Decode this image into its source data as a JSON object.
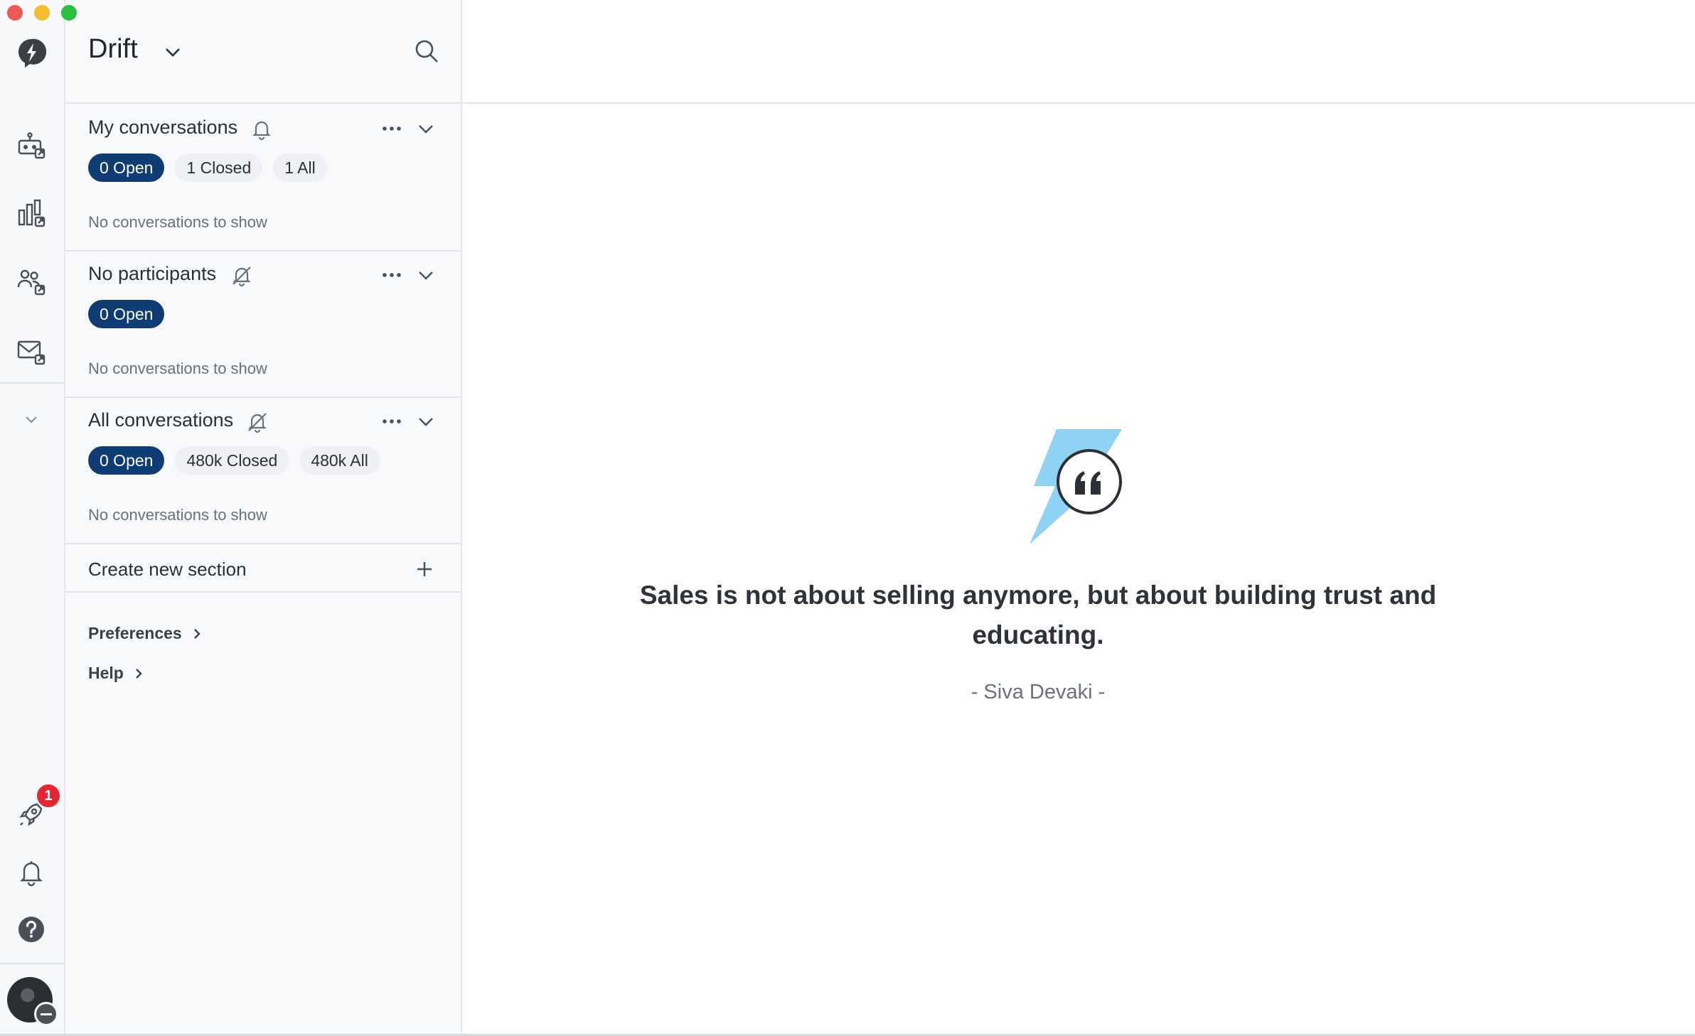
{
  "workspace": {
    "name": "Drift"
  },
  "sections": [
    {
      "title": "My conversations",
      "notifications": "on",
      "pills": [
        {
          "label": "0 Open",
          "active": true
        },
        {
          "label": "1 Closed",
          "active": false
        },
        {
          "label": "1 All",
          "active": false
        }
      ],
      "empty_text": "No conversations to show"
    },
    {
      "title": "No participants",
      "notifications": "muted",
      "pills": [
        {
          "label": "0 Open",
          "active": true
        }
      ],
      "empty_text": "No conversations to show"
    },
    {
      "title": "All conversations",
      "notifications": "muted",
      "pills": [
        {
          "label": "0 Open",
          "active": true
        },
        {
          "label": "480k Closed",
          "active": false
        },
        {
          "label": "480k All",
          "active": false
        }
      ],
      "empty_text": "No conversations to show"
    }
  ],
  "create_section": {
    "label": "Create new section"
  },
  "links": {
    "preferences": "Preferences",
    "help": "Help"
  },
  "rail": {
    "icons": [
      "drift-logo-icon",
      "bot-icon",
      "reports-icon",
      "contacts-icon",
      "email-icon",
      "chevron-down-icon",
      "rocket-icon",
      "bell-icon",
      "help-icon"
    ],
    "rocket_badge": "1"
  },
  "quote": {
    "text": "Sales is not about selling anymore, but about building trust and educating.",
    "author": "- Siva Devaki -"
  },
  "colors": {
    "accent": "#0f3d73",
    "badge": "#e3262f",
    "bolt": "#8fd3f4"
  }
}
